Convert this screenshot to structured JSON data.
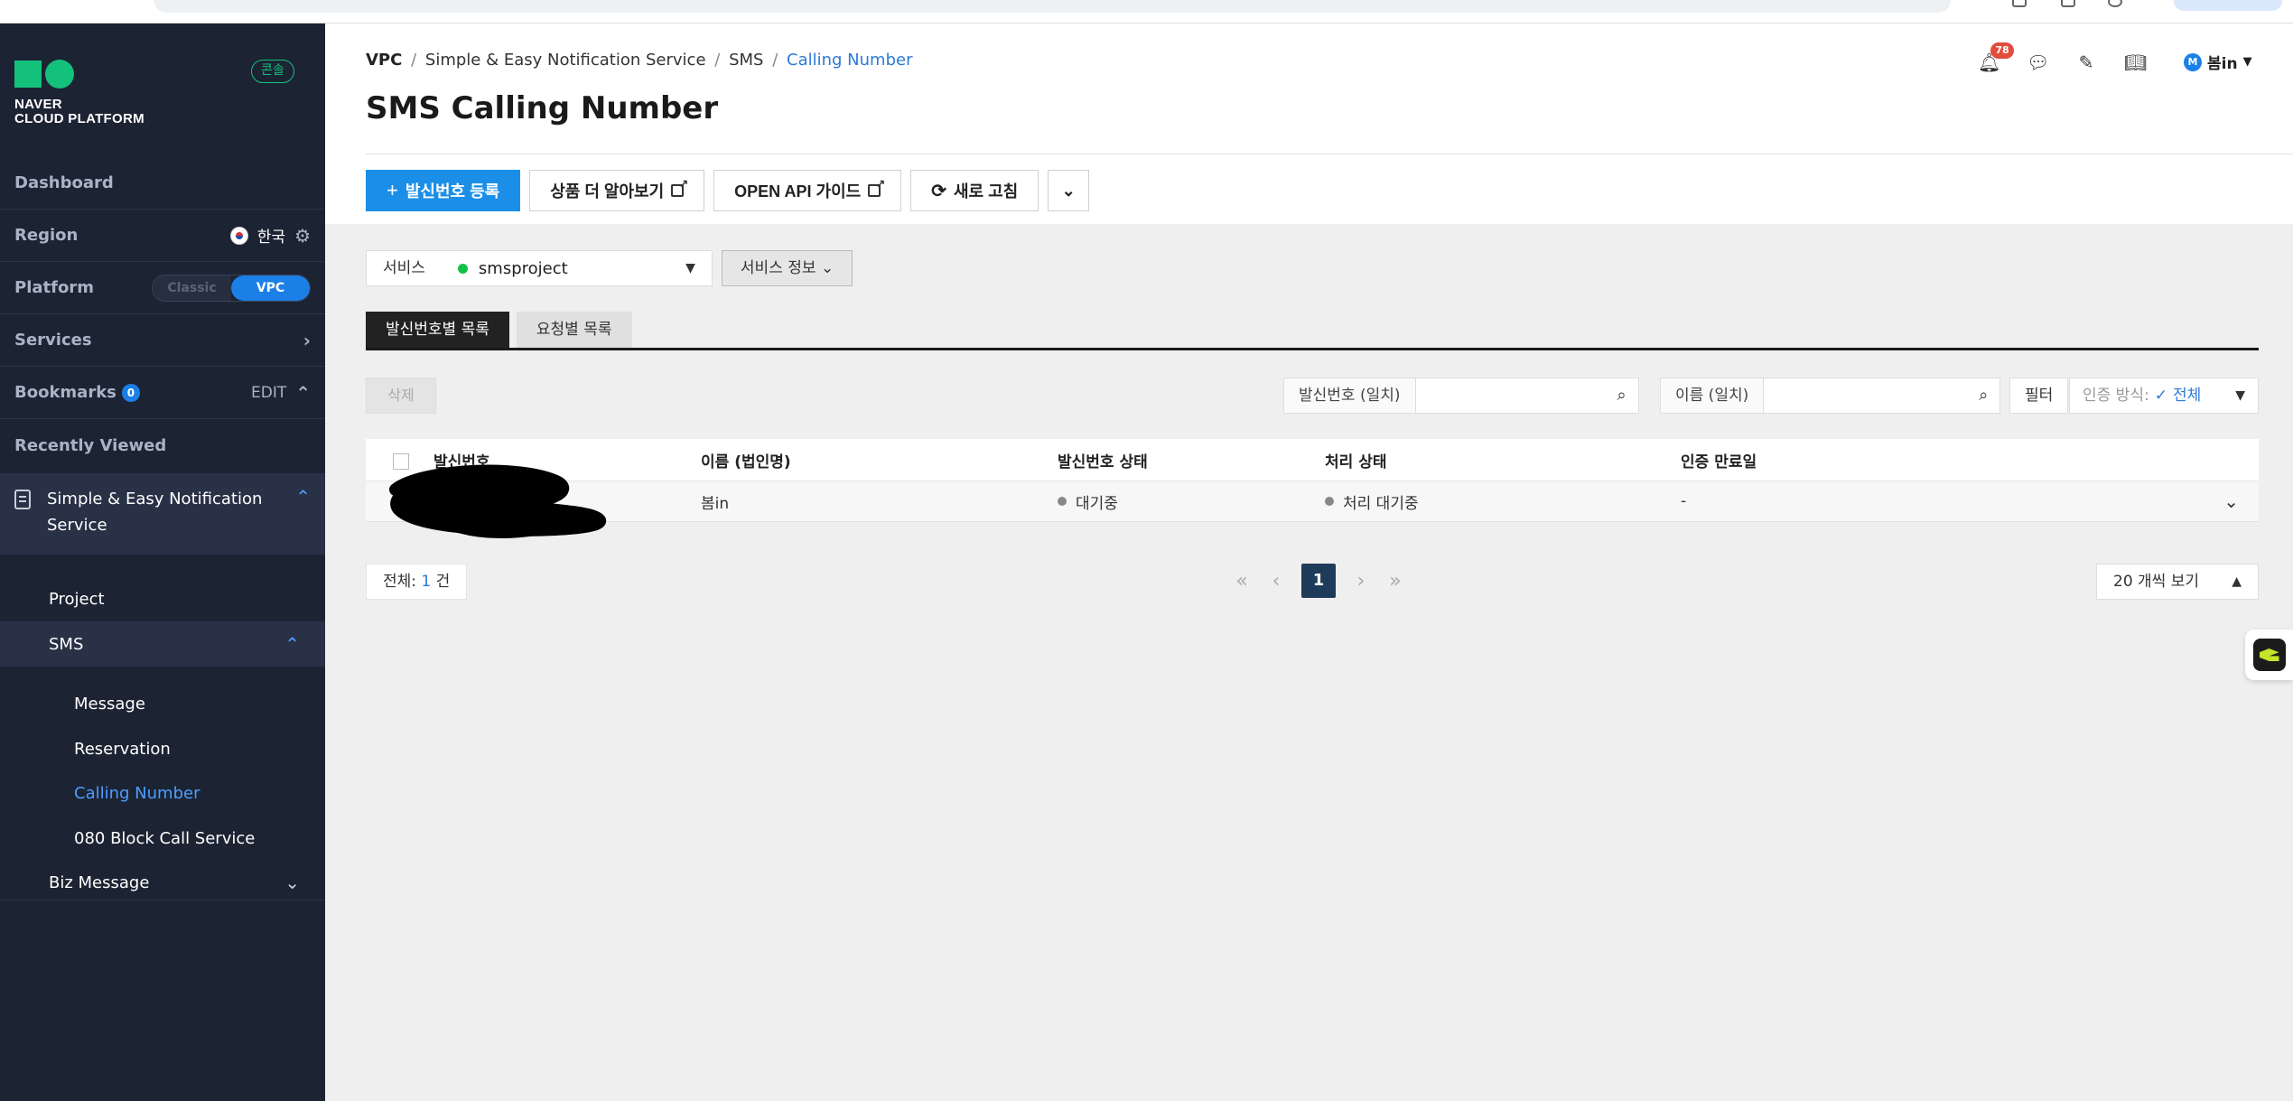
{
  "sidebar": {
    "logo_line1": "NAVER",
    "logo_line2": "CLOUD PLATFORM",
    "console_badge": "콘솔",
    "dashboard": "Dashboard",
    "region_label": "Region",
    "region_value": "한국",
    "platform_label": "Platform",
    "platform_classic": "Classic",
    "platform_vpc": "VPC",
    "services_label": "Services",
    "bookmarks_label": "Bookmarks",
    "bookmarks_count": "0",
    "bookmarks_edit": "EDIT",
    "recently_viewed": "Recently Viewed",
    "service_name": "Simple & Easy Notification Service",
    "sub_items": {
      "project": "Project",
      "sms": "SMS",
      "message": "Message",
      "reservation": "Reservation",
      "calling_number": "Calling Number",
      "block_call": "080 Block Call Service",
      "biz_message": "Biz Message"
    }
  },
  "header": {
    "breadcrumb": {
      "vpc": "VPC",
      "service": "Simple & Easy Notification Service",
      "sms": "SMS",
      "current": "Calling Number",
      "separator": "/"
    },
    "title": "SMS Calling Number",
    "notification_count": "78",
    "user_initial": "M",
    "user_name": "봄in"
  },
  "toolbar": {
    "register": "발신번호 등록",
    "learn_more": "상품 더 알아보기",
    "api_guide": "OPEN API 가이드",
    "refresh": "새로 고침"
  },
  "service_filter": {
    "label": "서비스",
    "selected": "smsproject",
    "info_button": "서비스 정보"
  },
  "tabs": [
    {
      "label": "발신번호별 목록"
    },
    {
      "label": "요청별 목록"
    }
  ],
  "actions": {
    "delete": "삭제",
    "search_number_label": "발신번호 (일치)",
    "search_name_label": "이름 (일치)",
    "filter": "필터",
    "auth_method_label": "인증 방식:",
    "auth_method_value": "전체"
  },
  "table": {
    "headers": {
      "number": "발신번호",
      "name": "이름 (법인명)",
      "number_status": "발신번호 상태",
      "process_status": "처리 상태",
      "auth_expiry": "인증 만료일"
    },
    "rows": [
      {
        "name": "봄in",
        "number_status": "대기중",
        "process_status": "처리 대기중",
        "auth_expiry": "-"
      }
    ]
  },
  "footer": {
    "total_prefix": "전체:",
    "total_count": "1",
    "total_suffix": "건",
    "current_page": "1",
    "per_page": "20 개씩 보기"
  }
}
